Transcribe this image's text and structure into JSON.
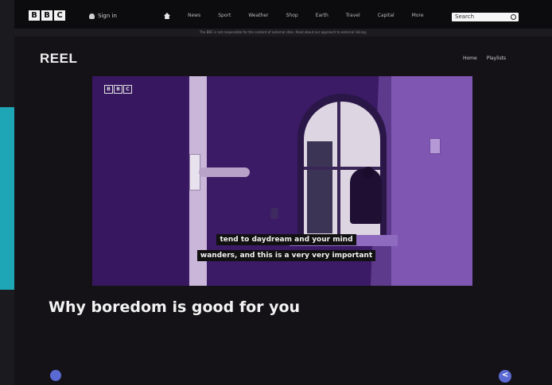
{
  "bbc_bar": {
    "logo_letters": [
      "B",
      "B",
      "C"
    ],
    "signin_label": "Sign in",
    "nav_items": [
      "News",
      "Sport",
      "Weather",
      "Shop",
      "Earth",
      "Travel",
      "Capital",
      "More"
    ],
    "search_placeholder": "Search",
    "icons": [
      "user-icon",
      "home-icon",
      "search-icon"
    ]
  },
  "notice": "The BBC is not responsible for the content of external sites. Read about our approach to external linking.",
  "reel": {
    "title": "REEL",
    "nav": [
      "Home",
      "Playlists"
    ]
  },
  "video": {
    "watermark_letters": [
      "B",
      "B",
      "C"
    ],
    "subtitle_line1": "tend to daydream and your mind",
    "subtitle_line2": "wanders, and this is a very very important"
  },
  "article": {
    "headline": "Why boredom is good for you",
    "date": "",
    "description": "",
    "author": ""
  },
  "colors": {
    "accent_teal": "#1ea6b6",
    "share_button": "#5b6ad3",
    "video_purple": "#3b1a66"
  }
}
